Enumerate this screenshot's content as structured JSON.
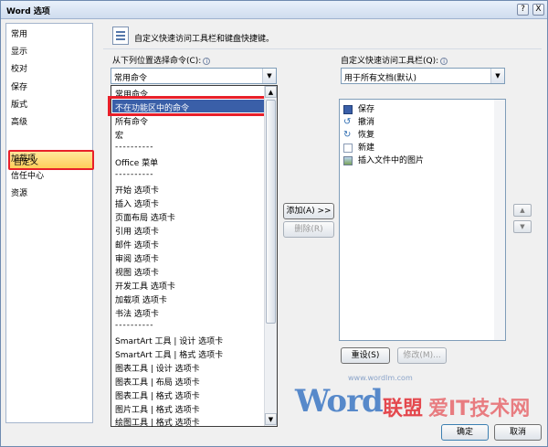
{
  "window": {
    "title": "Word 选项",
    "help_button": "?",
    "close_button": "X"
  },
  "sidebar": {
    "items": [
      {
        "label": "常用"
      },
      {
        "label": "显示"
      },
      {
        "label": "校对"
      },
      {
        "label": "保存"
      },
      {
        "label": "版式"
      },
      {
        "label": "高级"
      },
      {
        "label": "自定义"
      },
      {
        "label": "加载项"
      },
      {
        "label": "信任中心"
      },
      {
        "label": "资源"
      }
    ],
    "selected_index": 6
  },
  "header": {
    "text": "自定义快速访问工具栏和键盘快捷键。"
  },
  "left_panel": {
    "label": "从下列位置选择命令(C):",
    "combo_value": "常用命令",
    "dropdown_items": [
      "常用命令",
      "不在功能区中的命令",
      "所有命令",
      "宏",
      "----------",
      "Office 菜单",
      "----------",
      "开始 选项卡",
      "插入 选项卡",
      "页面布局 选项卡",
      "引用 选项卡",
      "邮件 选项卡",
      "审阅 选项卡",
      "视图 选项卡",
      "开发工具 选项卡",
      "加载项 选项卡",
      "书法 选项卡",
      "----------",
      "SmartArt 工具 | 设计 选项卡",
      "SmartArt 工具 | 格式 选项卡",
      "图表工具 | 设计 选项卡",
      "图表工具 | 布局 选项卡",
      "图表工具 | 格式 选项卡",
      "图片工具 | 格式 选项卡",
      "绘图工具 | 格式 选项卡"
    ],
    "highlighted_index": 1
  },
  "middle": {
    "add_button": "添加(A) >>",
    "remove_button": "删除(R)"
  },
  "right_panel": {
    "label": "自定义快速访问工具栏(Q):",
    "combo_value": "用于所有文档(默认)",
    "items": [
      {
        "label": "保存",
        "icon": "save-icon"
      },
      {
        "label": "撤消",
        "icon": "undo-icon"
      },
      {
        "label": "恢复",
        "icon": "redo-icon"
      },
      {
        "label": "新建",
        "icon": "new-document-icon"
      },
      {
        "label": "插入文件中的图片",
        "icon": "insert-picture-icon"
      }
    ],
    "reset_button": "重设(S)",
    "modify_button": "修改(M)..."
  },
  "footer": {
    "ok_button": "确定",
    "cancel_button": "取消"
  },
  "watermark": {
    "brand": "Word",
    "brand_suffix": "联盟",
    "url": "www.wordlm.com",
    "tagline": "爱IT技术网"
  },
  "colors": {
    "selection": "#3a5fa8",
    "highlight_box": "#e8202a",
    "nav_selected": "#ffd56b"
  }
}
